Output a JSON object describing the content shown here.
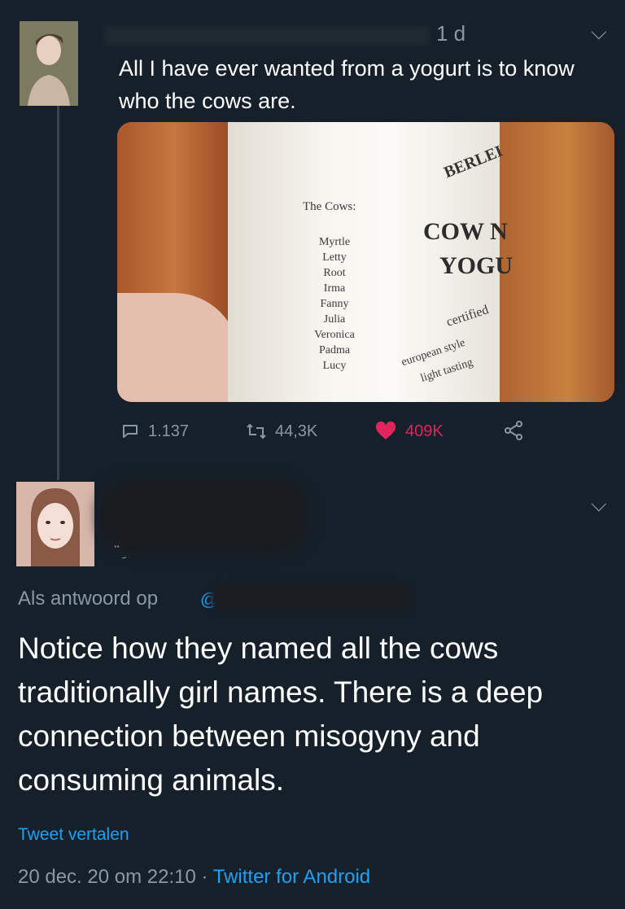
{
  "tweet1": {
    "time": "1 d",
    "text": "All I have ever wanted from a yogurt is to know who the cows are.",
    "image_text": {
      "label_title": "The Cows:",
      "cow_names": [
        "Myrtle",
        "Letty",
        "Root",
        "Irma",
        "Fanny",
        "Julia",
        "Veronica",
        "Padma",
        "Lucy"
      ],
      "brand": "BERLEI",
      "product_line1": "COW N",
      "product_line2": "YOGU",
      "certified": "certified",
      "style": "european style",
      "taste": "light tasting"
    },
    "actions": {
      "replies": "1.137",
      "retweets": "44,3K",
      "likes": "409K"
    }
  },
  "tweet2": {
    "handle_fragment": "ِ̈",
    "reply_prefix": "Als antwoord op",
    "reply_at": "@",
    "text": "Notice how they named all the cows traditionally girl names. There is a deep connection between misogyny and consuming animals.",
    "translate": "Tweet vertalen",
    "timestamp": "20 dec. 20 om 22:10",
    "separator": " · ",
    "source": "Twitter for Android"
  },
  "icons": {
    "reply": "speech-bubble",
    "retweet": "retweet-arrows",
    "like": "heart",
    "share": "share-nodes",
    "menu": "chevron-down"
  },
  "colors": {
    "background": "#15202b",
    "muted": "#8899a6",
    "link": "#1da1f2",
    "like": "#e0245e"
  }
}
